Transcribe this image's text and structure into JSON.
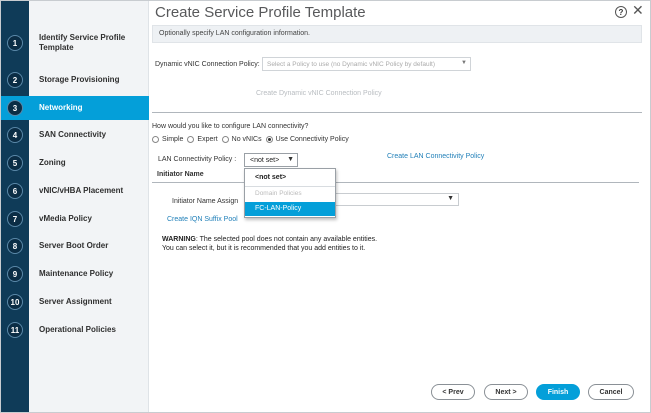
{
  "wizard": {
    "title": "Create Service Profile Template",
    "info": "Optionally specify LAN configuration information."
  },
  "steps": [
    {
      "num": "1",
      "label": "Identify Service Profile Template"
    },
    {
      "num": "2",
      "label": "Storage Provisioning"
    },
    {
      "num": "3",
      "label": "Networking"
    },
    {
      "num": "4",
      "label": "SAN Connectivity"
    },
    {
      "num": "5",
      "label": "Zoning"
    },
    {
      "num": "6",
      "label": "vNIC/vHBA Placement"
    },
    {
      "num": "7",
      "label": "vMedia Policy"
    },
    {
      "num": "8",
      "label": "Server Boot Order"
    },
    {
      "num": "9",
      "label": "Maintenance Policy"
    },
    {
      "num": "10",
      "label": "Server Assignment"
    },
    {
      "num": "11",
      "label": "Operational Policies"
    }
  ],
  "active_step": 3,
  "header": {
    "help": "?",
    "close": "✕"
  },
  "dynamic_vnic": {
    "label": "Dynamic vNIC Connection Policy:",
    "placeholder": "Select a Policy to use (no Dynamic vNIC Policy by default)",
    "create_link": "Create Dynamic vNIC Connection Policy"
  },
  "lan": {
    "question": "How would you like to configure LAN connectivity?",
    "options": [
      "Simple",
      "Expert",
      "No vNICs",
      "Use Connectivity Policy"
    ],
    "selected_option": "Use Connectivity Policy",
    "policy_label": "LAN Connectivity Policy :",
    "policy_value": "<not set>",
    "create_link": "Create LAN Connectivity Policy"
  },
  "initiator": {
    "heading": "Initiator Name",
    "assign_label": "Initiator Name Assign",
    "create_iqn": "Create IQN Suffix Pool",
    "warning_title": "WARNING",
    "warning_line1": ": The selected pool does not contain any available entities.",
    "warning_line2": "You can select it, but it is recommended that you add entities to it."
  },
  "dropdown": {
    "items": [
      "<not set>",
      "Domain Policies",
      "FC-LAN-Policy"
    ],
    "highlighted": "FC-LAN-Policy"
  },
  "footer": {
    "prev": "< Prev",
    "next": "Next >",
    "finish": "Finish",
    "cancel": "Cancel"
  },
  "colors": {
    "accent": "#049fd9",
    "rail": "#0f3b58",
    "link": "#1f7fb8"
  }
}
